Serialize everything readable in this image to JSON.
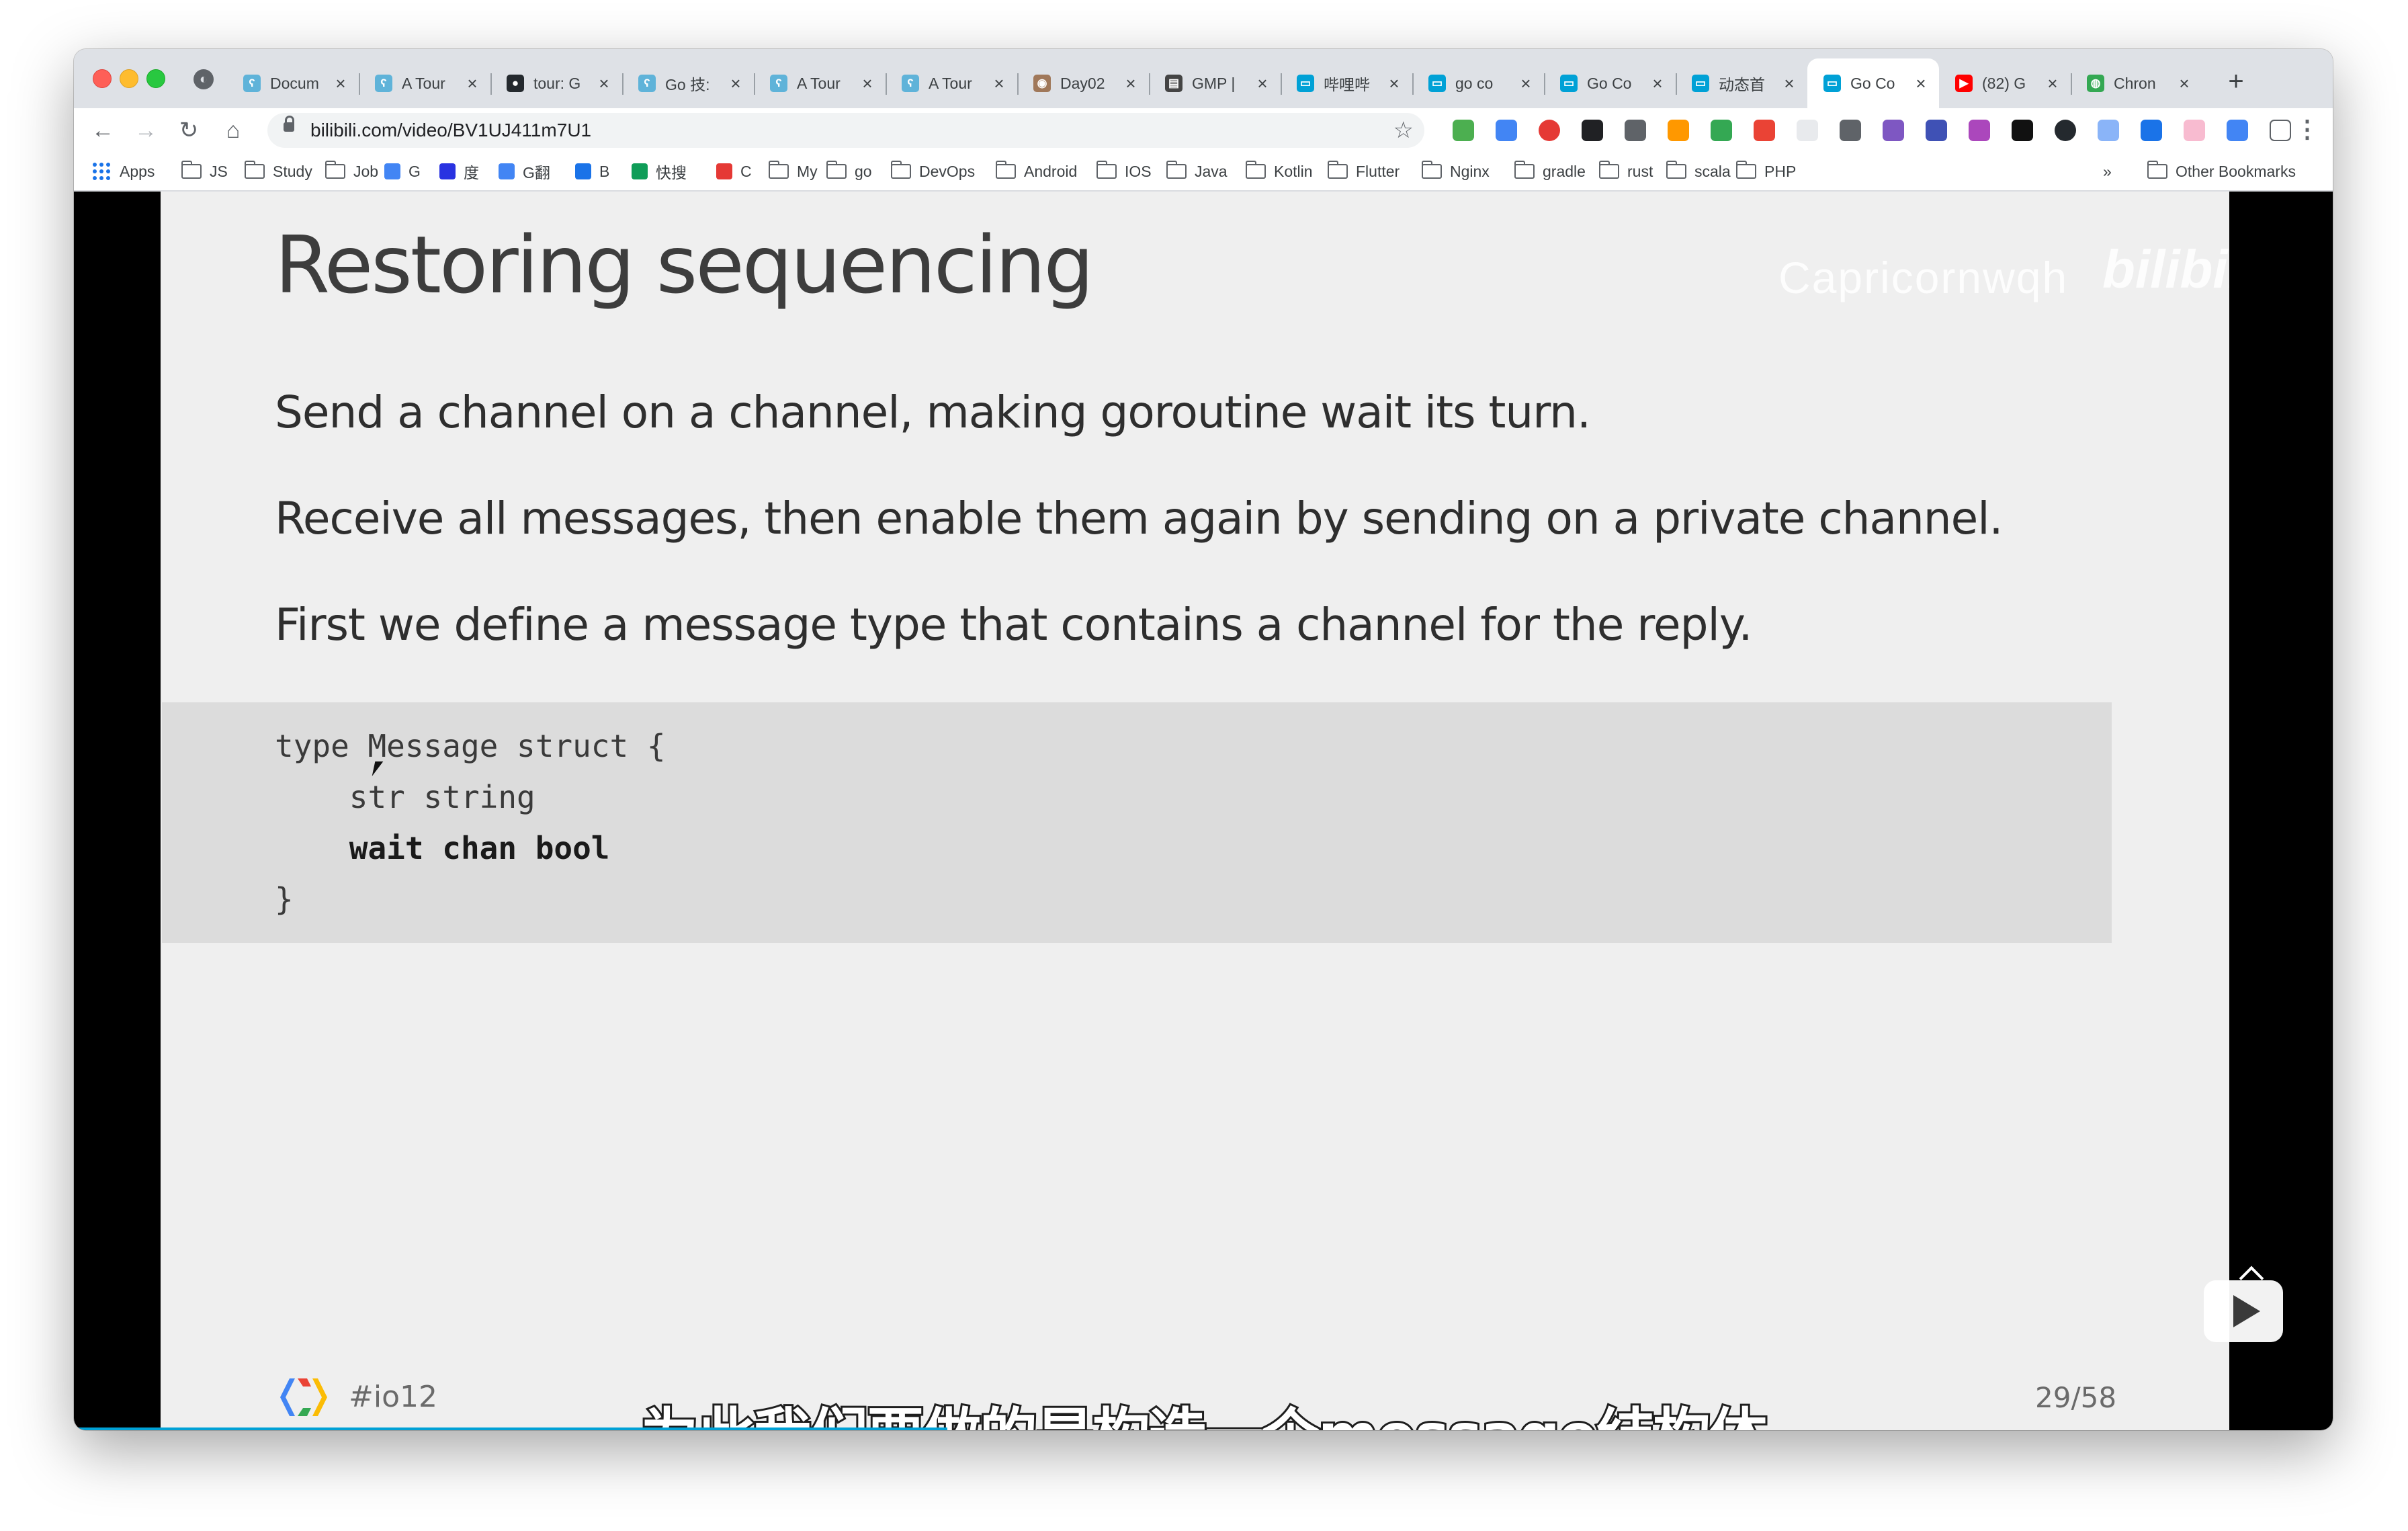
{
  "browser": {
    "tabs": [
      {
        "title": "Docum",
        "favicon": "gopher-doc-icon",
        "color": "#5fb3d9"
      },
      {
        "title": "A Tour",
        "favicon": "gopher-doc-icon",
        "color": "#5fb3d9"
      },
      {
        "title": "tour: G",
        "favicon": "github-icon",
        "color": "#24292e"
      },
      {
        "title": "Go 技:",
        "favicon": "gopher-doc-icon",
        "color": "#5fb3d9"
      },
      {
        "title": "A Tour",
        "favicon": "gopher-doc-icon",
        "color": "#5fb3d9"
      },
      {
        "title": "A Tour",
        "favicon": "gopher-doc-icon",
        "color": "#5fb3d9"
      },
      {
        "title": "Day02",
        "favicon": "avatar-icon",
        "color": "#a0785a"
      },
      {
        "title": "GMP |",
        "favicon": "book-icon",
        "color": "#444444"
      },
      {
        "title": "哔哩哔",
        "favicon": "bilibili-icon",
        "color": "#00a1d6"
      },
      {
        "title": "go co",
        "favicon": "bilibili-icon",
        "color": "#00a1d6"
      },
      {
        "title": "Go Co",
        "favicon": "bilibili-icon",
        "color": "#00a1d6"
      },
      {
        "title": "动态首",
        "favicon": "bilibili-icon",
        "color": "#00a1d6"
      },
      {
        "title": "Go Co",
        "favicon": "bilibili-icon",
        "color": "#00a1d6",
        "active": true
      },
      {
        "title": "(82) G",
        "favicon": "youtube-icon",
        "color": "#ff0000"
      },
      {
        "title": "Chron",
        "favicon": "chrome-icon",
        "color": "#34a853"
      }
    ],
    "close_glyph": "×",
    "new_tab_glyph": "+",
    "url": "bilibili.com/video/BV1UJ411m7U1",
    "bookmarks": [
      {
        "label": "Apps",
        "kind": "apps"
      },
      {
        "label": "JS",
        "kind": "folder"
      },
      {
        "label": "Study",
        "kind": "folder"
      },
      {
        "label": "Job",
        "kind": "folder"
      },
      {
        "label": "G",
        "kind": "google",
        "color": "#4285f4"
      },
      {
        "label": "度",
        "kind": "baidu",
        "color": "#2932e1"
      },
      {
        "label": "G翻",
        "kind": "translate",
        "color": "#4285f4"
      },
      {
        "label": "B",
        "kind": "translate2",
        "color": "#1a73e8"
      },
      {
        "label": "快搜",
        "kind": "quick",
        "color": "#0f9d58"
      },
      {
        "label": "C",
        "kind": "csdn",
        "color": "#e53935"
      },
      {
        "label": "My",
        "kind": "folder"
      },
      {
        "label": "go",
        "kind": "folder"
      },
      {
        "label": "DevOps",
        "kind": "folder"
      },
      {
        "label": "Android",
        "kind": "folder"
      },
      {
        "label": "IOS",
        "kind": "folder"
      },
      {
        "label": "Java",
        "kind": "folder"
      },
      {
        "label": "Kotlin",
        "kind": "folder"
      },
      {
        "label": "Flutter",
        "kind": "folder"
      },
      {
        "label": "Nginx",
        "kind": "folder"
      },
      {
        "label": "gradle",
        "kind": "folder"
      },
      {
        "label": "rust",
        "kind": "folder"
      },
      {
        "label": "scala",
        "kind": "folder"
      },
      {
        "label": "PHP",
        "kind": "folder"
      }
    ],
    "more_bookmarks": "»",
    "other_bookmarks": "Other Bookmarks"
  },
  "slide": {
    "title": "Restoring sequencing",
    "paragraphs": [
      "Send a channel on a channel, making goroutine wait its turn.",
      "Receive all messages, then enable them again by sending on a private channel.",
      "First we define a message type that contains a channel for the reply."
    ],
    "code": [
      "type Message struct {",
      "    str string",
      "    wait chan bool",
      "}"
    ],
    "hashtag": "#io12",
    "page": "29/58"
  },
  "video": {
    "watermark": "Capricornwqh",
    "watermark_logo": "bilibili",
    "subtitle": "为此我们要做的是构造一个message结构体"
  }
}
